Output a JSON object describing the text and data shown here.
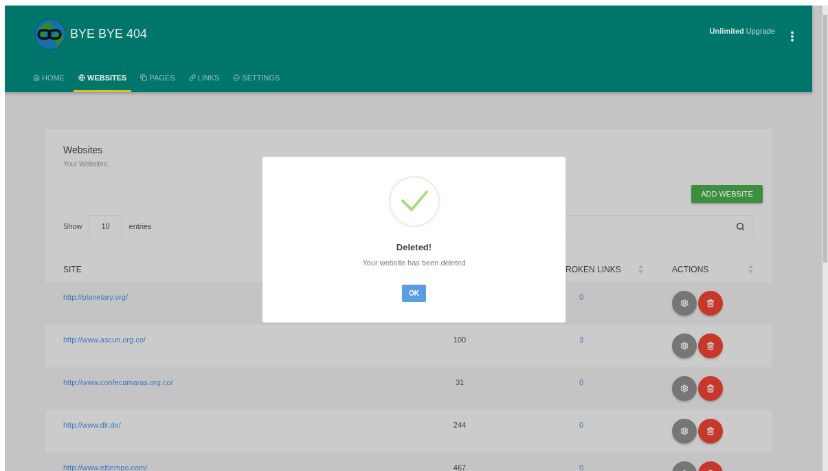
{
  "header": {
    "title": "BYE BYE 404",
    "upgrade": "**Unlimited** Upgrade"
  },
  "nav": [
    {
      "label": "HOME",
      "selected": false
    },
    {
      "label": "WEBSITES",
      "selected": true
    },
    {
      "label": "PAGES",
      "selected": false
    },
    {
      "label": "LINKS",
      "selected": false
    },
    {
      "label": "SETTINGS",
      "selected": false
    }
  ],
  "card": {
    "title": "Websites",
    "subtitle": "Your Websites.",
    "add_button": "ADD WEBSITE",
    "show_label": "Show",
    "page_size": "10",
    "entries_label": "entries"
  },
  "table": {
    "columns": {
      "site": "SITE",
      "broken_links": "ROKEN LINKS",
      "actions": "ACTIONS"
    },
    "rows": [
      {
        "site": "http://planetary.org/",
        "broken_links": "0"
      },
      {
        "site": "http://www.ascun.org.co/",
        "column_2": "100",
        "broken_links": "3"
      },
      {
        "site": "http://www.confecamaras.org.co/",
        "column_2": "31",
        "broken_links": "0"
      },
      {
        "site": "http://www.dlr.de/",
        "column_2": "244",
        "broken_links": "0"
      },
      {
        "site": "http://www.eltiempo.com/",
        "column_2": "467",
        "broken_links": "0"
      }
    ]
  },
  "dialog": {
    "title": "Deleted!",
    "message": "Your website has been deleted",
    "button": "OK"
  }
}
